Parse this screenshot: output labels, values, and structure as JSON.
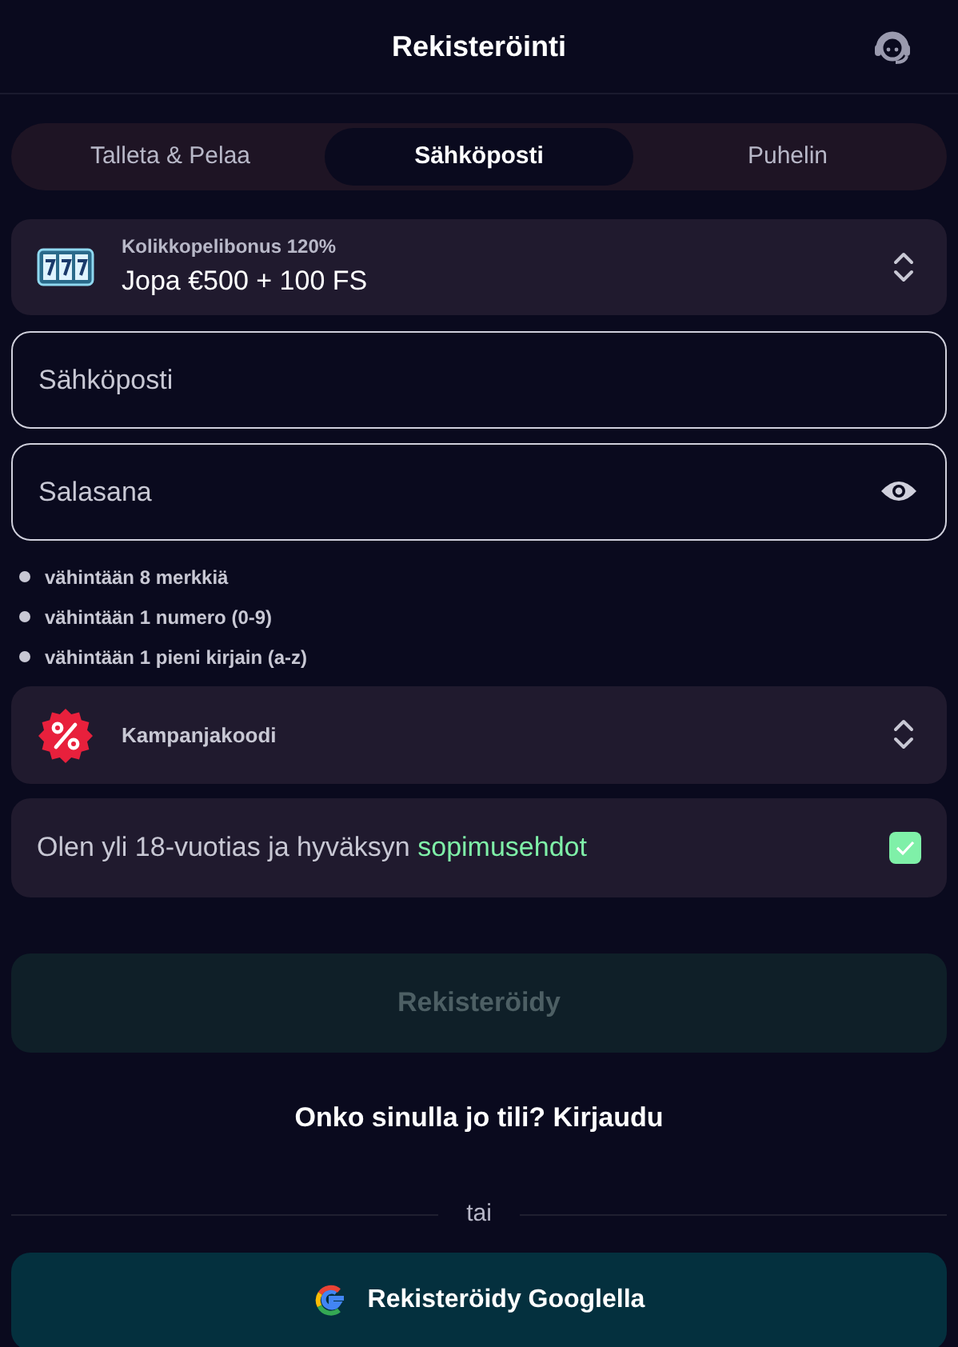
{
  "header": {
    "title": "Rekisteröinti"
  },
  "tabs": [
    {
      "label": "Talleta & Pelaa",
      "selected": false
    },
    {
      "label": "Sähköposti",
      "selected": true
    },
    {
      "label": "Puhelin",
      "selected": false
    }
  ],
  "bonus": {
    "label": "Kolikkopelibonus 120%",
    "value": "Jopa €500 + 100 FS"
  },
  "fields": [
    {
      "kind": "text",
      "placeholder": "Sähköposti"
    },
    {
      "kind": "password",
      "placeholder": "Salasana"
    }
  ],
  "password_rules": [
    "vähintään 8 merkkiä",
    "vähintään 1 numero (0-9)",
    "vähintään 1 pieni kirjain (a-z)"
  ],
  "promo": {
    "label": "Kampanjakoodi"
  },
  "terms": {
    "text": "Olen yli 18-vuotias ja hyväksyn",
    "link": "sopimusehdot",
    "checked": true
  },
  "register_button": {
    "label": "Rekisteröidy",
    "disabled": true
  },
  "login": {
    "text": "Onko sinulla jo tili?",
    "link": "Kirjaudu"
  },
  "divider": "tai",
  "google_button": {
    "label": "Rekisteröidy Googlella"
  }
}
